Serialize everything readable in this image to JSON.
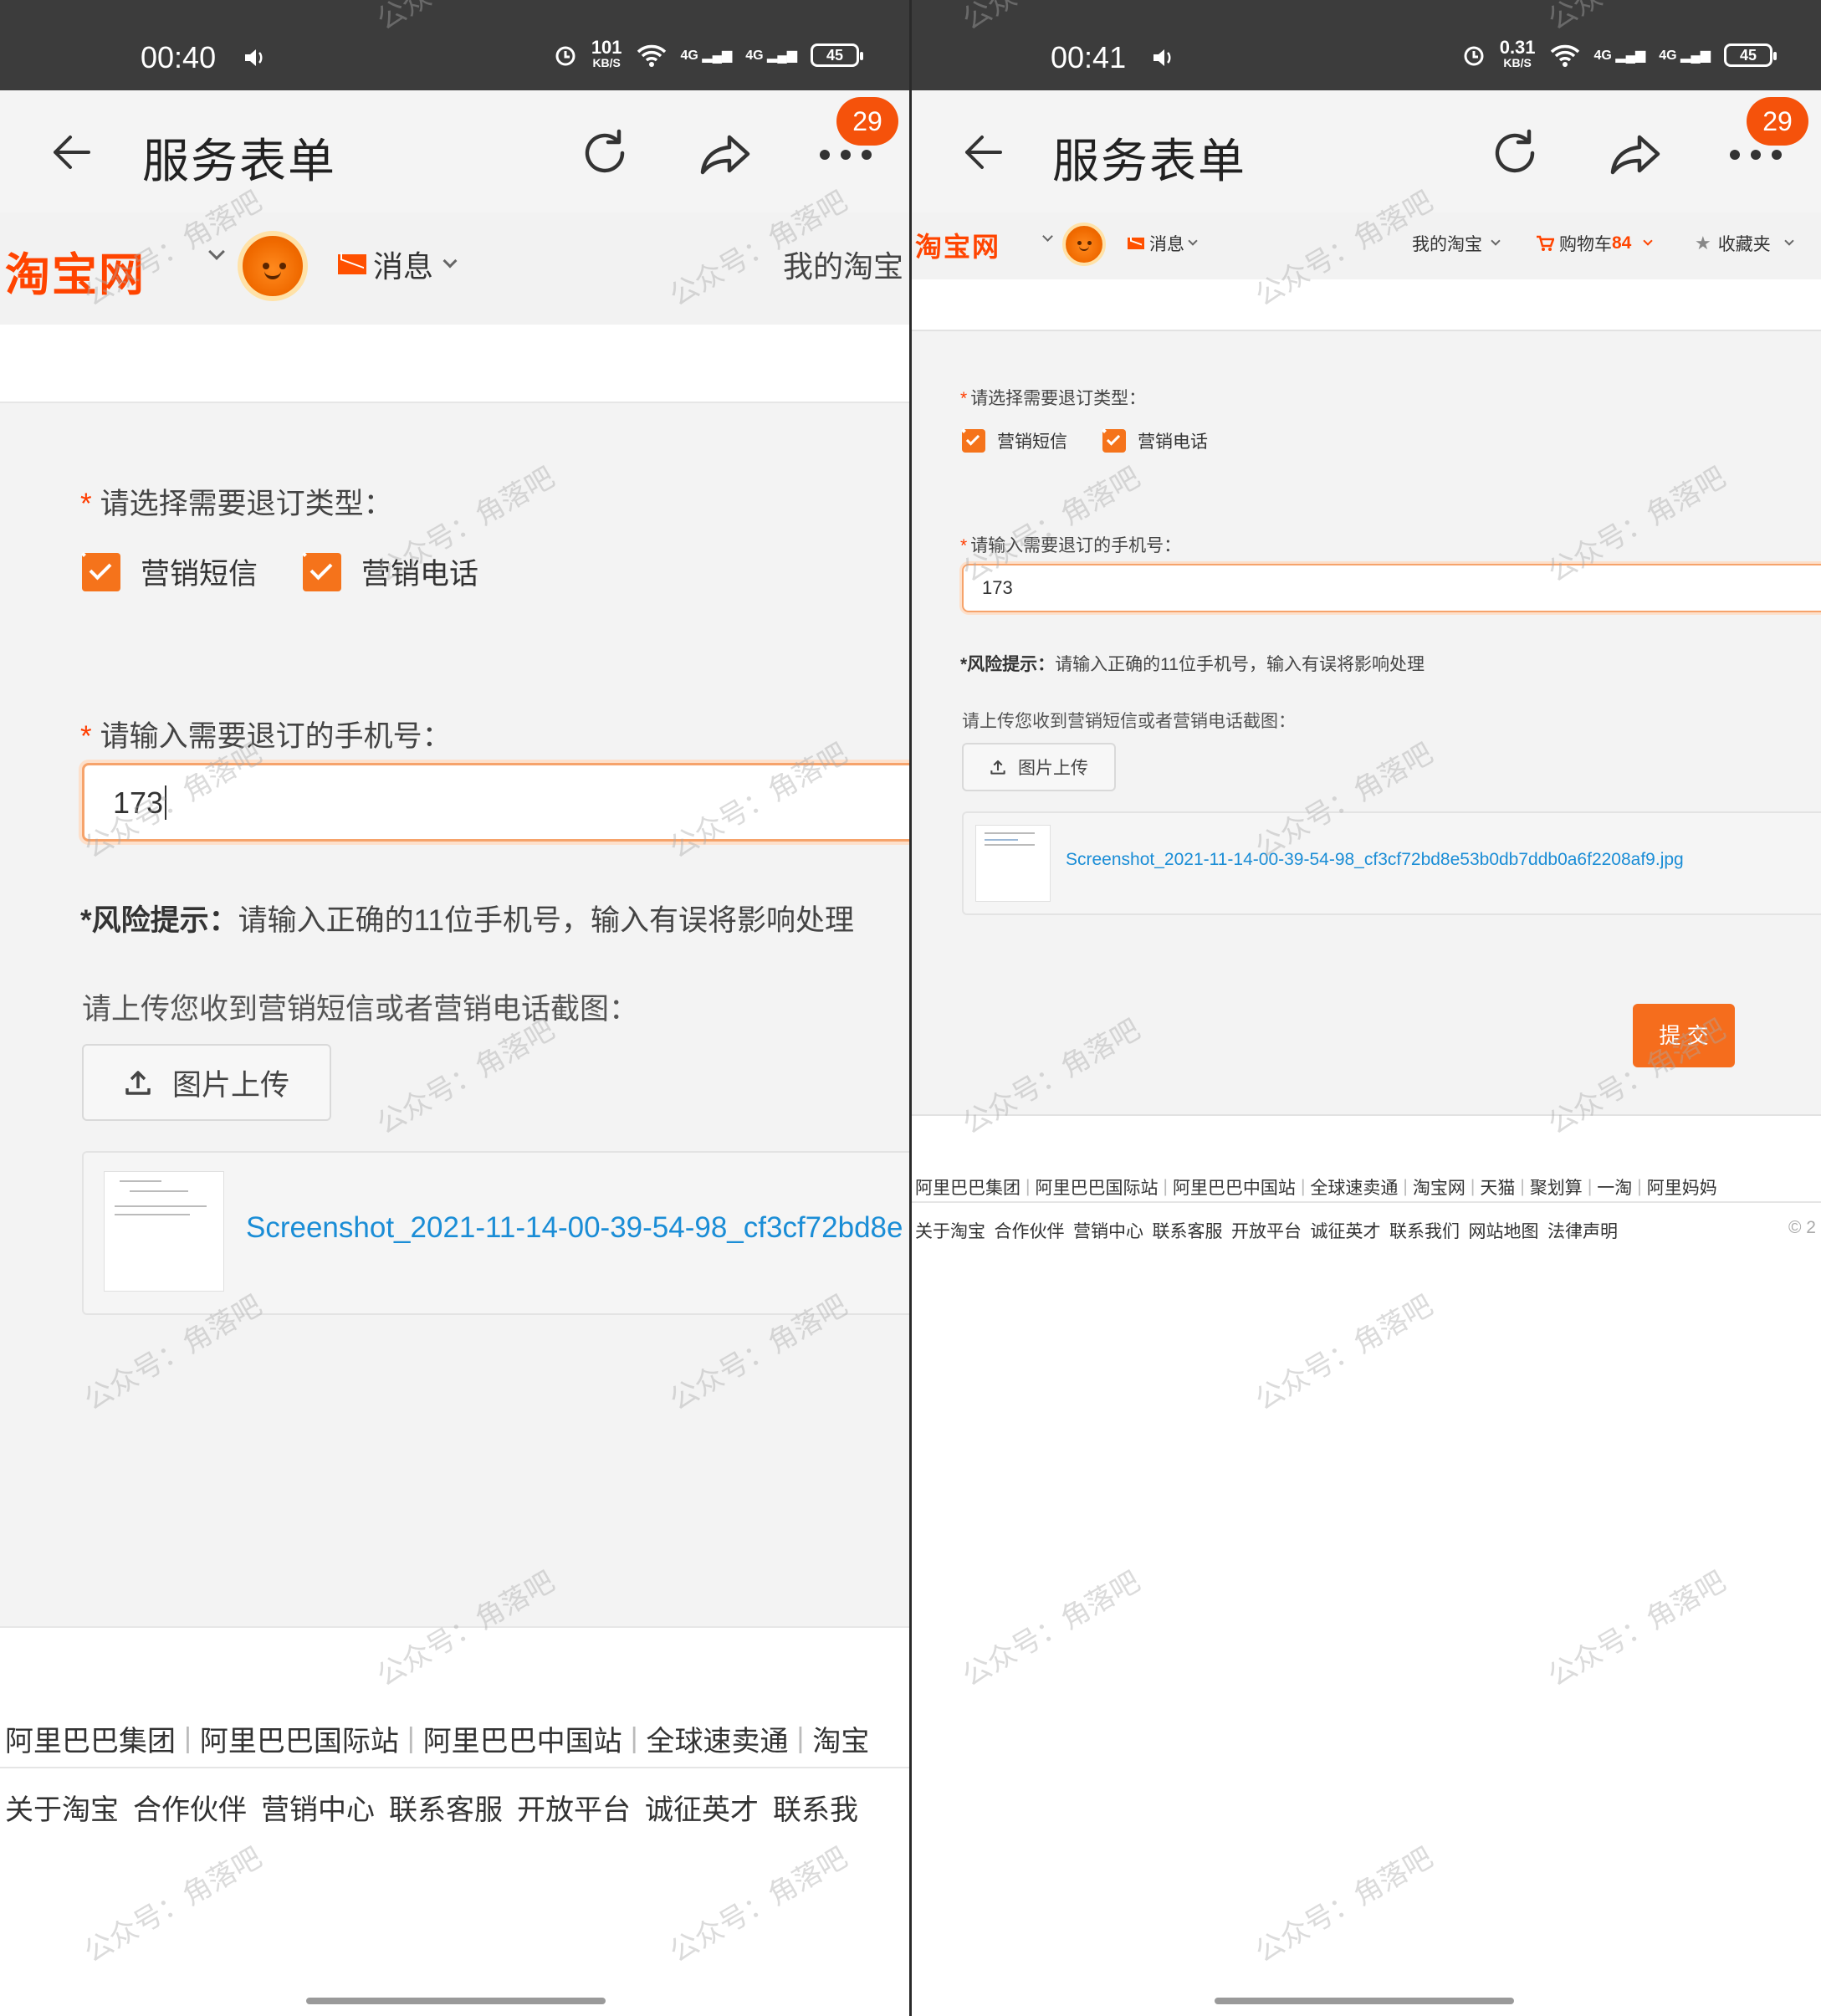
{
  "left": {
    "status": {
      "time": "00:40",
      "speed_value": "101",
      "speed_unit": "KB/S",
      "net1": "4G",
      "net2": "4G",
      "battery": "45"
    },
    "header": {
      "title": "服务表单",
      "badge": "29"
    },
    "nav": {
      "logo": "淘宝网",
      "messages": "消息",
      "my_taobao": "我的淘宝"
    },
    "form": {
      "type_label": "请选择需要退订类型：",
      "required_mark": "*",
      "checkbox_sms": "营销短信",
      "checkbox_call": "营销电话",
      "phone_label": "请输入需要退订的手机号：",
      "phone_value": "173",
      "risk_title": "*风险提示：",
      "risk_text": "请输入正确的11位手机号，输入有误将影响处理",
      "upload_hint": "请上传您收到营销短信或者营销电话截图：",
      "upload_button": "图片上传",
      "file_name": "Screenshot_2021-11-14-00-39-54-98_cf3cf72bd8e"
    },
    "footer": {
      "row1": [
        "阿里巴巴集团",
        "阿里巴巴国际站",
        "阿里巴巴中国站",
        "全球速卖通",
        "淘宝"
      ],
      "row2": [
        "关于淘宝",
        "合作伙伴",
        "营销中心",
        "联系客服",
        "开放平台",
        "诚征英才",
        "联系我"
      ]
    }
  },
  "right": {
    "status": {
      "time": "00:41",
      "speed_value": "0.31",
      "speed_unit": "KB/S",
      "net1": "4G",
      "net2": "4G",
      "battery": "45"
    },
    "header": {
      "title": "服务表单",
      "badge": "29"
    },
    "nav": {
      "logo": "淘宝网",
      "messages": "消息",
      "my_taobao": "我的淘宝",
      "cart": "购物车",
      "cart_count": "84",
      "favorites": "收藏夹"
    },
    "form": {
      "type_label": "请选择需要退订类型：",
      "required_mark": "*",
      "checkbox_sms": "营销短信",
      "checkbox_call": "营销电话",
      "phone_label": "请输入需要退订的手机号：",
      "phone_value": "173",
      "risk_title": "*风险提示：",
      "risk_text": "请输入正确的11位手机号，输入有误将影响处理",
      "upload_hint": "请上传您收到营销短信或者营销电话截图：",
      "upload_button": "图片上传",
      "file_name": "Screenshot_2021-11-14-00-39-54-98_cf3cf72bd8e53b0db7ddb0a6f2208af9.jpg",
      "submit": "提 交"
    },
    "footer": {
      "row1": [
        "阿里巴巴集团",
        "阿里巴巴国际站",
        "阿里巴巴中国站",
        "全球速卖通",
        "淘宝网",
        "天猫",
        "聚划算",
        "一淘",
        "阿里妈妈"
      ],
      "row2": [
        "关于淘宝",
        "合作伙伴",
        "营销中心",
        "联系客服",
        "开放平台",
        "诚征英才",
        "联系我们",
        "网站地图",
        "法律声明"
      ],
      "copyright": "© 2"
    }
  },
  "watermark": "公众号：角落吧",
  "colors": {
    "accent": "#f56d1d",
    "logo": "#ff4400",
    "link": "#1a8dd6",
    "badge": "#f5520b"
  }
}
